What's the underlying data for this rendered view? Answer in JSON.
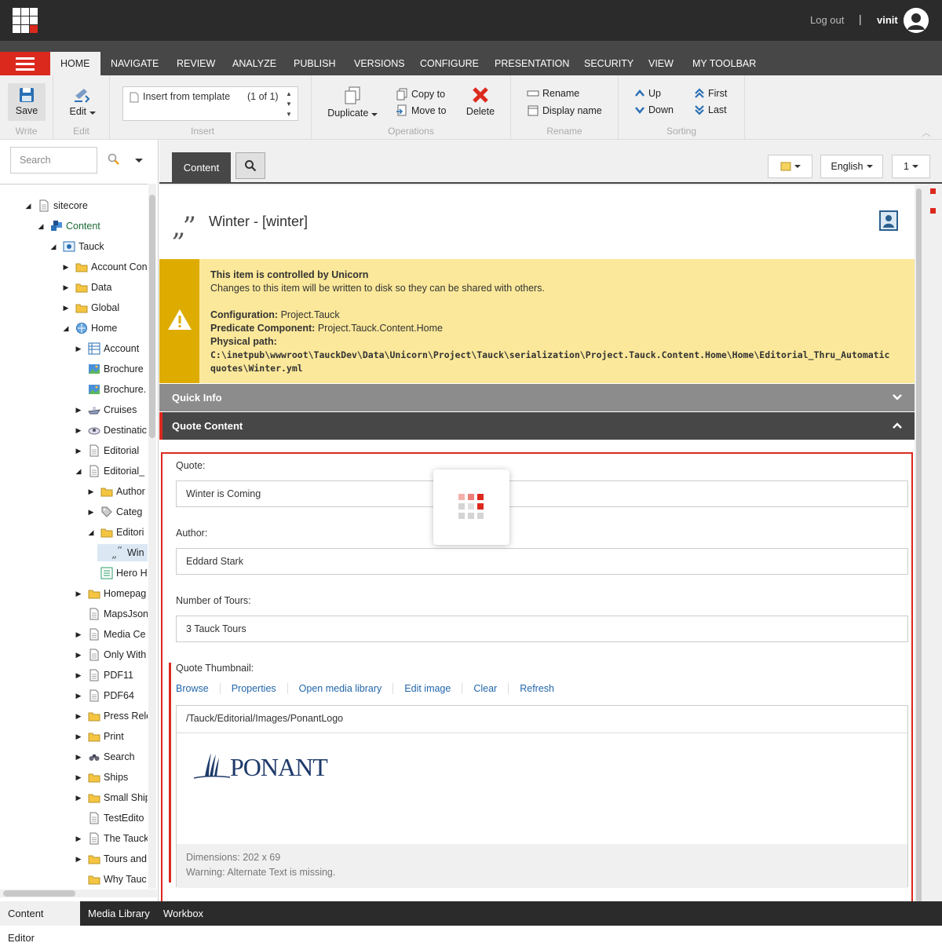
{
  "topbar": {
    "logout": "Log out",
    "separator": "|",
    "username": "vinit"
  },
  "ribbon_tabs": [
    "HOME",
    "NAVIGATE",
    "REVIEW",
    "ANALYZE",
    "PUBLISH",
    "VERSIONS",
    "CONFIGURE",
    "PRESENTATION",
    "SECURITY",
    "VIEW",
    "MY TOOLBAR"
  ],
  "ribbon": {
    "write": {
      "label": "Write",
      "save": "Save"
    },
    "edit": {
      "label": "Edit",
      "edit": "Edit"
    },
    "insert": {
      "label": "Insert",
      "template": "Insert from template",
      "count": "(1 of 1)"
    },
    "operations": {
      "label": "Operations",
      "duplicate": "Duplicate",
      "copy_to": "Copy to",
      "move_to": "Move to",
      "delete": "Delete"
    },
    "rename": {
      "label": "Rename",
      "rename": "Rename",
      "display_name": "Display name"
    },
    "sorting": {
      "label": "Sorting",
      "up": "Up",
      "down": "Down",
      "first": "First",
      "last": "Last"
    }
  },
  "search": {
    "placeholder": "Search"
  },
  "tree": [
    {
      "label": "sitecore",
      "level": 0,
      "toggle": "open",
      "icon": "doc-icon"
    },
    {
      "label": "Content",
      "level": 1,
      "toggle": "open",
      "icon": "content-icon"
    },
    {
      "label": "Tauck",
      "level": 2,
      "toggle": "open",
      "icon": "site-icon"
    },
    {
      "label": "Account Con",
      "level": 3,
      "toggle": "closed",
      "icon": "folder-icon"
    },
    {
      "label": "Data",
      "level": 3,
      "toggle": "closed",
      "icon": "folder-icon"
    },
    {
      "label": "Global",
      "level": 3,
      "toggle": "closed",
      "icon": "folder-icon"
    },
    {
      "label": "Home",
      "level": 3,
      "toggle": "open",
      "icon": "globe-icon"
    },
    {
      "label": "Account",
      "level": 4,
      "toggle": "closed",
      "icon": "grid-icon"
    },
    {
      "label": "Brochure",
      "level": 4,
      "toggle": "none",
      "icon": "image-icon"
    },
    {
      "label": "Brochure.",
      "level": 4,
      "toggle": "none",
      "icon": "image-icon"
    },
    {
      "label": "Cruises",
      "level": 4,
      "toggle": "closed",
      "icon": "ship-icon"
    },
    {
      "label": "Destinatic",
      "level": 4,
      "toggle": "closed",
      "icon": "map-icon"
    },
    {
      "label": "Editorial",
      "level": 4,
      "toggle": "closed",
      "icon": "doc-icon"
    },
    {
      "label": "Editorial_",
      "level": 4,
      "toggle": "open",
      "icon": "doc-icon"
    },
    {
      "label": "Author",
      "level": 5,
      "toggle": "closed",
      "icon": "folder-icon"
    },
    {
      "label": "Categ",
      "level": 5,
      "toggle": "closed",
      "icon": "tag-icon"
    },
    {
      "label": "Editori",
      "level": 5,
      "toggle": "open",
      "icon": "folder-icon"
    },
    {
      "label": "Win",
      "level": 6,
      "toggle": "none",
      "icon": "quote-icon",
      "selected": true
    },
    {
      "label": "Hero H",
      "level": 5,
      "toggle": "none",
      "icon": "list-icon"
    },
    {
      "label": "Homepag",
      "level": 4,
      "toggle": "closed",
      "icon": "folder-icon"
    },
    {
      "label": "MapsJson",
      "level": 4,
      "toggle": "none",
      "icon": "doc-icon"
    },
    {
      "label": "Media Ce",
      "level": 4,
      "toggle": "closed",
      "icon": "doc-icon"
    },
    {
      "label": "Only With",
      "level": 4,
      "toggle": "closed",
      "icon": "doc-icon"
    },
    {
      "label": "PDF11",
      "level": 4,
      "toggle": "closed",
      "icon": "doc-icon"
    },
    {
      "label": "PDF64",
      "level": 4,
      "toggle": "closed",
      "icon": "doc-icon"
    },
    {
      "label": "Press Rele",
      "level": 4,
      "toggle": "closed",
      "icon": "folder-icon"
    },
    {
      "label": "Print",
      "level": 4,
      "toggle": "closed",
      "icon": "folder-icon"
    },
    {
      "label": "Search",
      "level": 4,
      "toggle": "closed",
      "icon": "binoculars-icon"
    },
    {
      "label": "Ships",
      "level": 4,
      "toggle": "closed",
      "icon": "folder-icon"
    },
    {
      "label": "Small Ship",
      "level": 4,
      "toggle": "closed",
      "icon": "folder-icon"
    },
    {
      "label": "TestEdito",
      "level": 4,
      "toggle": "none",
      "icon": "doc-icon"
    },
    {
      "label": "The Tauck",
      "level": 4,
      "toggle": "closed",
      "icon": "doc-icon"
    },
    {
      "label": "Tours and",
      "level": 4,
      "toggle": "closed",
      "icon": "folder-icon"
    },
    {
      "label": "Why Tauc",
      "level": 4,
      "toggle": "none",
      "icon": "folder-icon"
    }
  ],
  "content_tabs": {
    "content": "Content",
    "language": "English",
    "version": "1"
  },
  "item": {
    "title": "Winter - [winter]"
  },
  "warning": {
    "title": "This item is controlled by Unicorn",
    "subtitle": "Changes to this item will be written to disk so they can be shared with others.",
    "config_label": "Configuration:",
    "config_value": "Project.Tauck",
    "predicate_label": "Predicate Component:",
    "predicate_value": "Project.Tauck.Content.Home",
    "path_label": "Physical path:",
    "path_line1": "C:\\inetpub\\wwwroot\\TauckDev\\Data\\Unicorn\\Project\\Tauck\\serialization\\Project.Tauck.Content.Home\\Home\\Editorial_Thru_Automatic",
    "path_line2": "quotes\\Winter.yml"
  },
  "sections": {
    "quick_info": "Quick Info",
    "quote_content": "Quote Content"
  },
  "fields": {
    "quote_label": "Quote:",
    "quote_value": "Winter is Coming",
    "author_label": "Author:",
    "author_value": "Eddard Stark",
    "tours_label": "Number of Tours:",
    "tours_value": "3 Tauck Tours",
    "thumb_label": "Quote Thumbnail:",
    "thumb_actions": [
      "Browse",
      "Properties",
      "Open media library",
      "Edit image",
      "Clear",
      "Refresh"
    ],
    "thumb_path": "/Tauck/Editorial/Images/PonantLogo",
    "logo_text": "PONANT",
    "dimensions": "Dimensions: 202 x 69",
    "alt_warning": "Warning: Alternate Text is missing."
  },
  "bottom_tabs": [
    "Content Editor",
    "Media Library",
    "Workbox"
  ],
  "colors": {
    "accent": "#dc291e",
    "dark": "#2b2b2b",
    "warning_bg": "#fbe89a",
    "warning_side": "#deac00",
    "link": "#2266aa"
  }
}
